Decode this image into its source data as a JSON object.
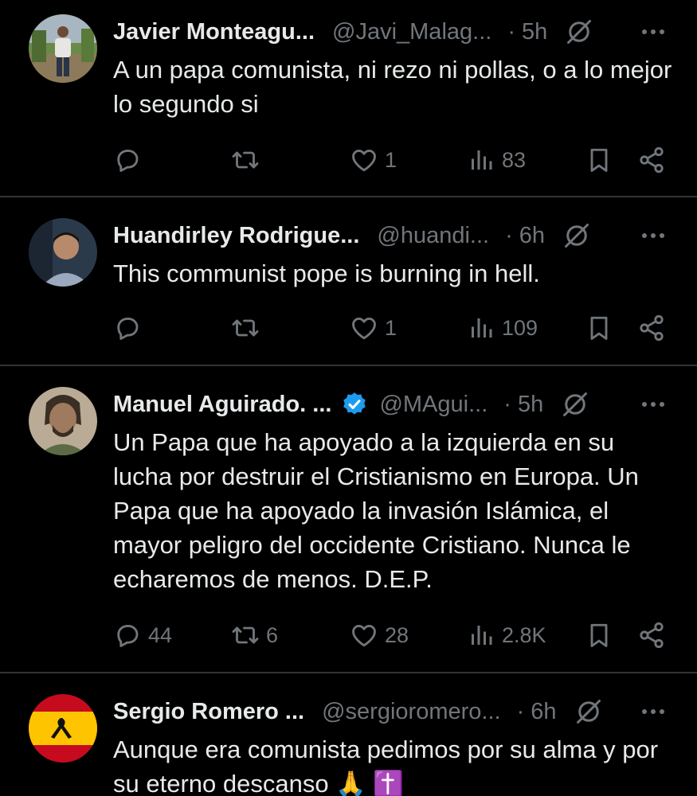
{
  "tweets": [
    {
      "name": "Javier Monteagu...",
      "handle": "@Javi_Malag...",
      "time": "5h",
      "text": "A un papa comunista, ni rezo ni pollas, o a lo mejor lo segundo si",
      "replies": "",
      "retweets": "",
      "likes": "1",
      "views": "83",
      "verified": false
    },
    {
      "name": "Huandirley Rodrigue...",
      "handle": "@huandi...",
      "time": "6h",
      "text": "This communist pope is burning in hell.",
      "replies": "",
      "retweets": "",
      "likes": "1",
      "views": "109",
      "verified": false
    },
    {
      "name": "Manuel Aguirado. ...",
      "handle": "@MAgui...",
      "time": "5h",
      "text": "Un Papa que ha apoyado a la izquierda en su lucha por destruir el Cristianismo en Europa. Un Papa que ha apoyado la invasión Islámica, el mayor peligro del occidente Cristiano. Nunca le echaremos de menos. D.E.P.",
      "replies": "44",
      "retweets": "6",
      "likes": "28",
      "views": "2.8K",
      "verified": true
    },
    {
      "name": "Sergio Romero ...",
      "handle": "@sergioromero...",
      "time": "6h",
      "text": "Aunque era comunista pedimos por su alma y por su eterno descanso 🙏 ✝️",
      "verified": false
    }
  ],
  "separator": "·",
  "colors": {
    "background": "#000000",
    "text": "#e7e9ea",
    "muted": "#71767b",
    "divider": "#2f3336",
    "verified": "#1d9bf0"
  }
}
